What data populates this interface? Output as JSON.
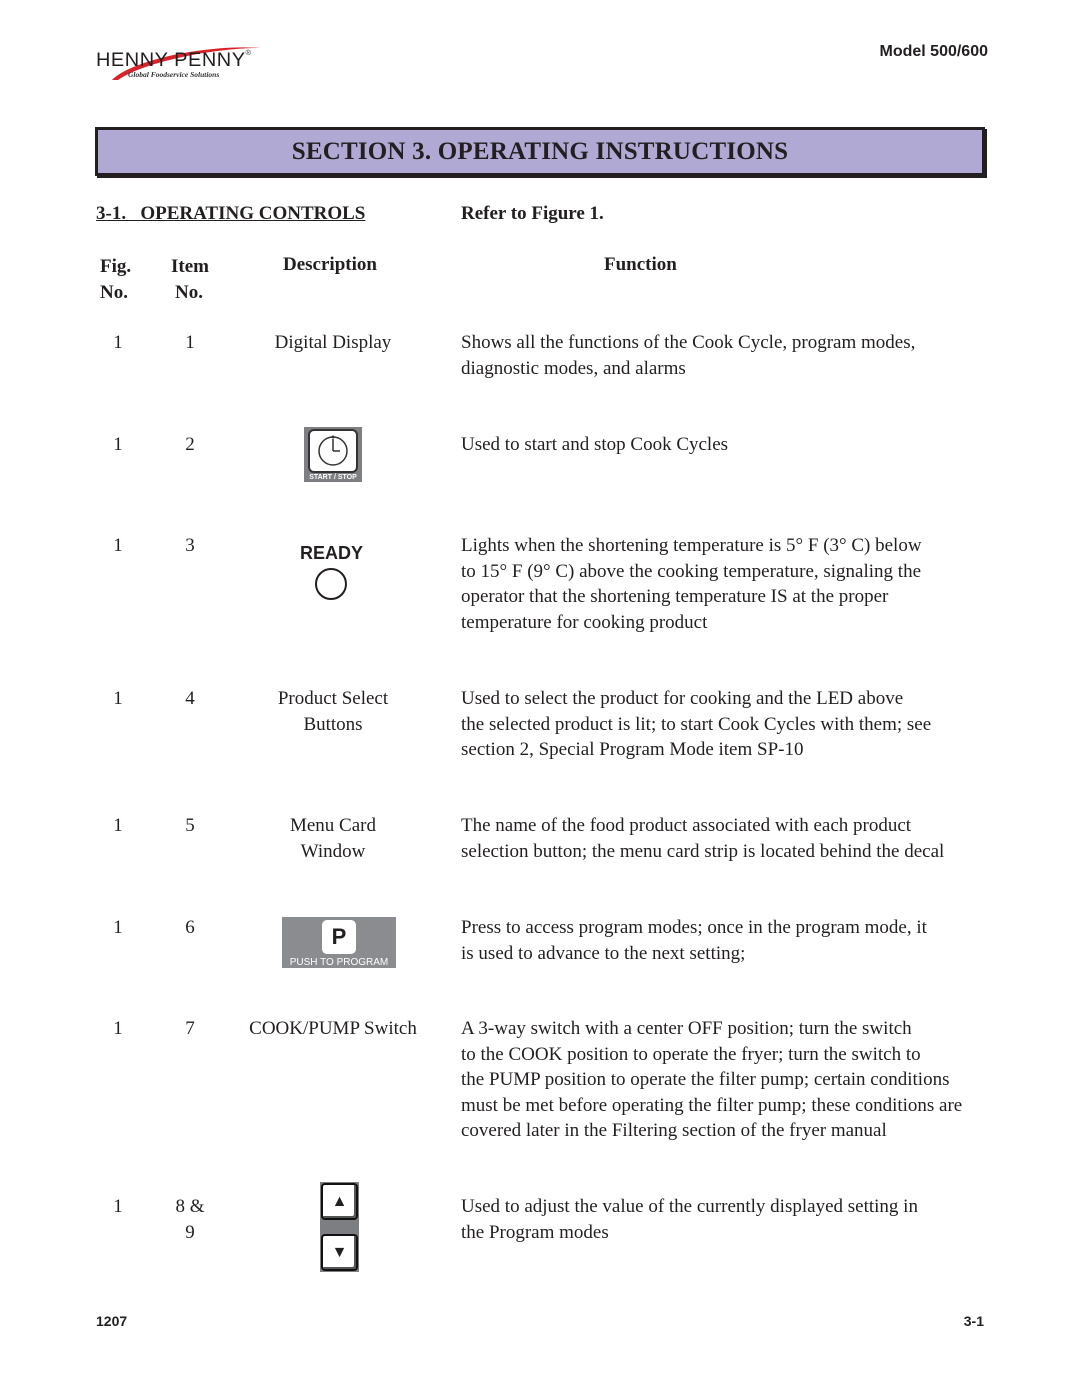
{
  "header": {
    "logo": {
      "brand": "HENNY PENNY",
      "registered": "®",
      "tagline": "Global Foodservice Solutions"
    },
    "model": "Model 500/600"
  },
  "section_banner": "SECTION 3. OPERATING INSTRUCTIONS",
  "subsection": {
    "title": "3-1.   OPERATING CONTROLS",
    "refer": "Refer to Figure 1."
  },
  "columns": {
    "fig": [
      "Fig.",
      "No."
    ],
    "item": [
      "Item",
      "No."
    ],
    "description": "Description",
    "function": "Function"
  },
  "rows": [
    {
      "fig": "1",
      "item": "1",
      "description": [
        "Digital Display"
      ],
      "icon": null,
      "function": [
        "Shows all the functions of the Cook Cycle, program modes,",
        "diagnostic modes, and alarms"
      ]
    },
    {
      "fig": "1",
      "item": "2",
      "description": [],
      "icon": {
        "name": "start-stop-button-icon",
        "label": "START / STOP"
      },
      "function": [
        "Used to start and stop Cook Cycles"
      ]
    },
    {
      "fig": "1",
      "item": "3",
      "description": [],
      "icon": {
        "name": "ready-light-icon",
        "label": "READY"
      },
      "function": [
        "Lights when the shortening temperature is 5° F (3° C) below",
        "to 15° F (9° C) above the cooking temperature, signaling the",
        "operator that the shortening temperature IS at the proper",
        "temperature for cooking product"
      ]
    },
    {
      "fig": "1",
      "item": "4",
      "description": [
        "Product Select",
        "Buttons"
      ],
      "icon": null,
      "function": [
        "Used to select the product for cooking and the LED above",
        "the selected product is lit; to start Cook Cycles with them; see",
        "section 2, Special Program Mode item SP-10"
      ]
    },
    {
      "fig": "1",
      "item": "5",
      "description": [
        "Menu Card",
        "Window"
      ],
      "icon": null,
      "function": [
        "The name of the food product associated with each product",
        "selection button; the menu card strip is located behind the decal"
      ]
    },
    {
      "fig": "1",
      "item": "6",
      "description": [],
      "icon": {
        "name": "push-to-program-button-icon",
        "key": "P",
        "label": "PUSH TO PROGRAM"
      },
      "function": [
        "Press to access program modes; once in the program mode, it",
        "is used to advance to the next setting;"
      ]
    },
    {
      "fig": "1",
      "item": "7",
      "description": [
        "COOK/PUMP Switch"
      ],
      "icon": null,
      "function": [
        "A 3-way switch with a center OFF position; turn the switch",
        "to the COOK position to operate the fryer; turn the switch to",
        "the PUMP position to operate the filter pump; certain conditions",
        "must be met before operating the filter pump; these conditions are",
        "covered later in the Filtering section of the fryer manual"
      ]
    },
    {
      "fig": "1",
      "item": "8 & 9",
      "description": [],
      "icon": {
        "name": "up-down-arrow-buttons-icon",
        "up": "▲",
        "down": "▼"
      },
      "function": [
        "Used to adjust the value of the currently displayed setting in",
        "the Program modes"
      ]
    }
  ],
  "footer": {
    "left": "1207",
    "right": "3-1"
  }
}
